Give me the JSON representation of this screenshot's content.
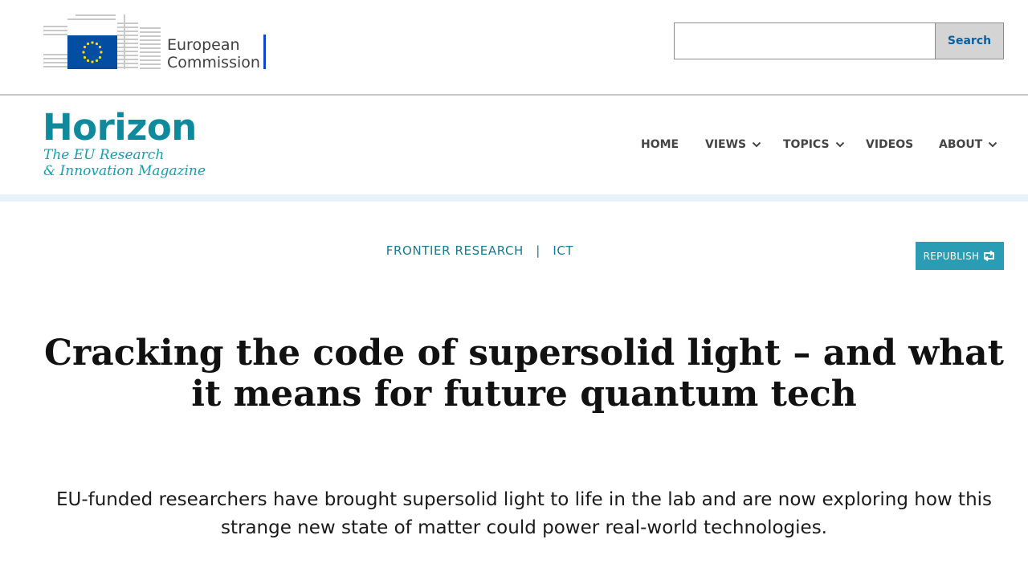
{
  "ec": {
    "logo_line1": "European",
    "logo_line2": "Commission"
  },
  "search": {
    "value": "",
    "placeholder": "",
    "button_label": "Search"
  },
  "horizon": {
    "title": "Horizon",
    "subtitle_line1": "The EU Research",
    "subtitle_line2": "& Innovation Magazine"
  },
  "nav": {
    "items": [
      {
        "label": "HOME",
        "has_dropdown": false
      },
      {
        "label": "VIEWS",
        "has_dropdown": true
      },
      {
        "label": "TOPICS",
        "has_dropdown": true
      },
      {
        "label": "VIDEOS",
        "has_dropdown": false
      },
      {
        "label": "ABOUT",
        "has_dropdown": true
      }
    ]
  },
  "article": {
    "category1": "FRONTIER RESEARCH",
    "separator": "|",
    "category2": "ICT",
    "republish_label": "REPUBLISH",
    "headline": "Cracking the code of supersolid light – and what it means for future quantum tech",
    "standfirst": "EU-funded researchers have brought supersolid light to life in the lab and are now exploring how this strange new state of matter could power real-world technologies."
  },
  "colors": {
    "horizon_teal": "#0f8a9c",
    "ec_blue": "#0e47cb",
    "republish_bg": "#2a9db4",
    "category_text": "#167a96"
  }
}
